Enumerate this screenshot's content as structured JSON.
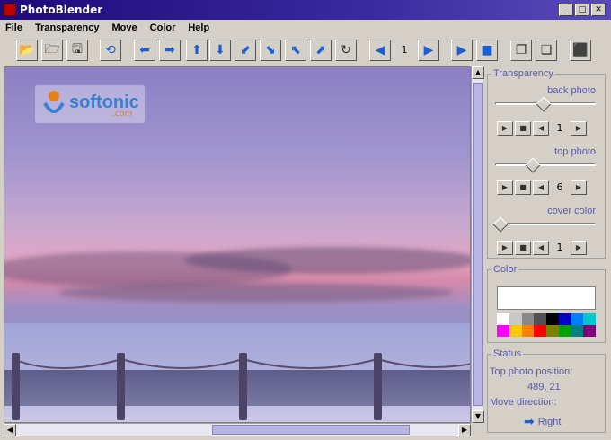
{
  "window": {
    "title": "PhotoBlender",
    "buttons": [
      "_",
      "□",
      "✕"
    ]
  },
  "menu": [
    "File",
    "Transparency",
    "Move",
    "Color",
    "Help"
  ],
  "toolbar": {
    "frame_number": "1",
    "icons": [
      "open-icon",
      "open-second-icon",
      "save-icon",
      "swap-icon",
      "move-left-icon",
      "move-right-icon",
      "move-up-icon",
      "move-down-icon",
      "move-down-left-icon",
      "move-down-right-icon",
      "move-up-left-icon",
      "move-up-right-icon",
      "rotate-icon",
      "previous-frame-icon",
      "next-frame-icon",
      "play-icon",
      "stop-icon",
      "bring-front-icon",
      "send-back-icon",
      "exit-icon"
    ]
  },
  "watermark": {
    "text": "softonic",
    "sub": ".com"
  },
  "transparency": {
    "legend": "Transparency",
    "back_photo": {
      "label": "back photo",
      "value": "1",
      "level": 0.48
    },
    "top_photo": {
      "label": "top photo",
      "value": "6",
      "level": 0.36
    },
    "cover_color": {
      "label": "cover color",
      "value": "1",
      "level": 0.0
    }
  },
  "color": {
    "legend": "Color",
    "selected": "#ffffff",
    "palette": [
      "#ffffff",
      "#c8c8c8",
      "#888888",
      "#505050",
      "#000000",
      "#0000c8",
      "#0080ff",
      "#00c8c8",
      "#ff00ff",
      "#ffc800",
      "#ff8000",
      "#ff0000",
      "#808000",
      "#00a000",
      "#008080",
      "#800080"
    ]
  },
  "status": {
    "legend": "Status",
    "position_label": "Top photo position:",
    "position_value": "489, 21",
    "direction_label": "Move direction:",
    "direction_value": "Right"
  }
}
